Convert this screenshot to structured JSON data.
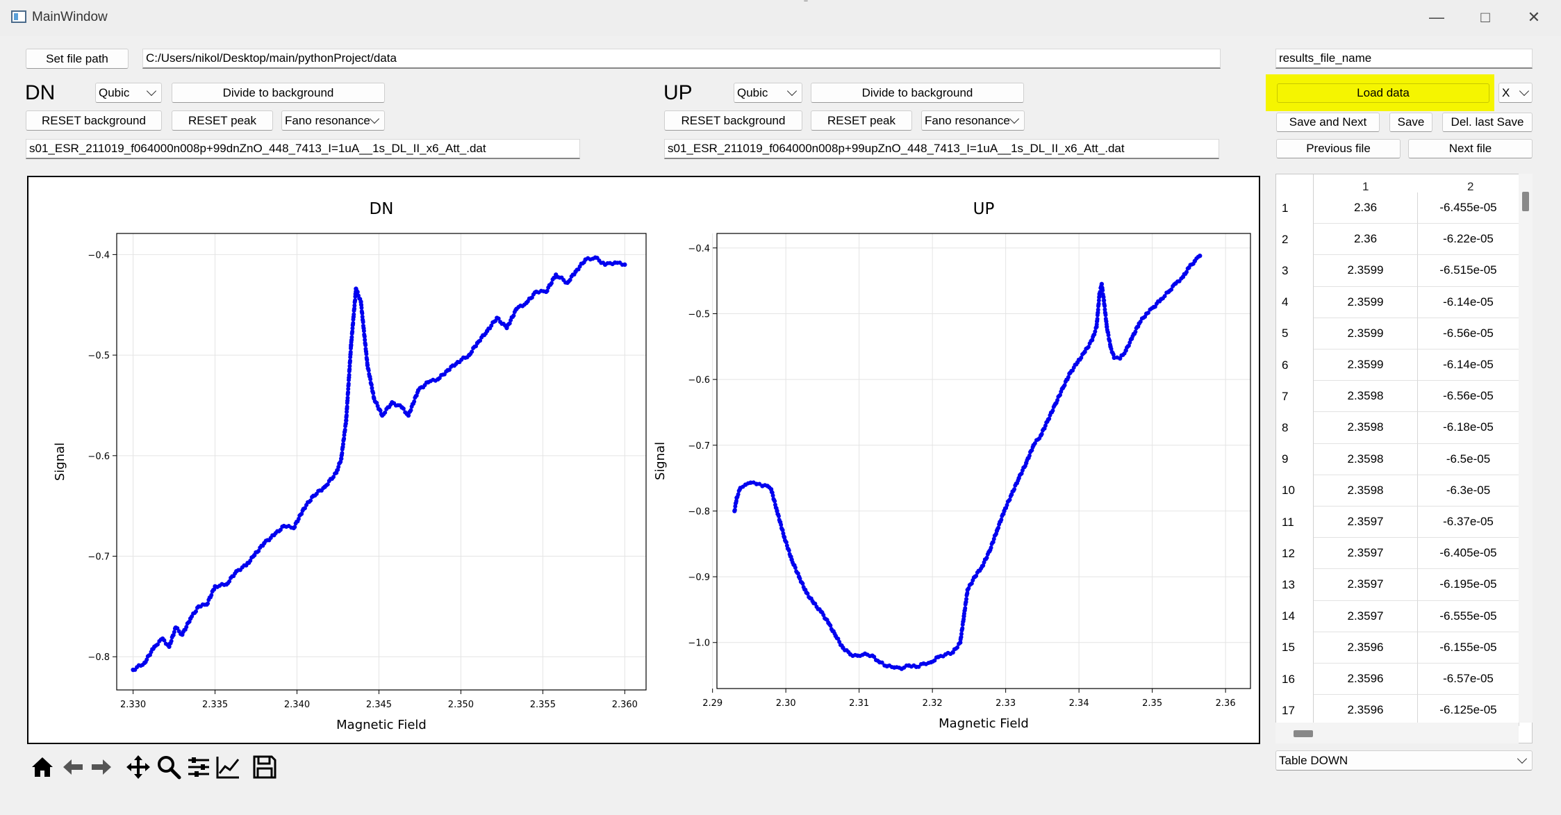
{
  "window": {
    "title": "MainWindow"
  },
  "top": {
    "set_file_path_label": "Set file path",
    "file_path_value": "C:/Users/nikol/Desktop/main/pythonProject/data",
    "results_file_name_value": "results_file_name",
    "load_data_label": "Load data",
    "axis_select_value": "X"
  },
  "dn_panel": {
    "label": "DN",
    "fit_select_value": "Qubic",
    "divide_label": "Divide to background",
    "reset_background_label": "RESET background",
    "reset_peak_label": "RESET peak",
    "peak_model_value": "Fano resonance",
    "file_name": "s01_ESR_211019_f064000n008p+99dnZnO_448_7413_I=1uA__1s_DL_II_x6_Att_.dat"
  },
  "up_panel": {
    "label": "UP",
    "fit_select_value": "Qubic",
    "divide_label": "Divide to background",
    "reset_background_label": "RESET background",
    "reset_peak_label": "RESET peak",
    "peak_model_value": "Fano resonance",
    "file_name": "s01_ESR_211019_f064000n008p+99upZnO_448_7413_I=1uA__1s_DL_II_x6_Att_.dat"
  },
  "actions": {
    "save_and_next": "Save and Next",
    "save": "Save",
    "del_last_save": "Del. last Save",
    "previous_file": "Previous file",
    "next_file": "Next file"
  },
  "table": {
    "columns": [
      "1",
      "2"
    ],
    "rows": [
      [
        "1",
        "2.36",
        "-6.455e-05"
      ],
      [
        "2",
        "2.36",
        "-6.22e-05"
      ],
      [
        "3",
        "2.3599",
        "-6.515e-05"
      ],
      [
        "4",
        "2.3599",
        "-6.14e-05"
      ],
      [
        "5",
        "2.3599",
        "-6.56e-05"
      ],
      [
        "6",
        "2.3599",
        "-6.14e-05"
      ],
      [
        "7",
        "2.3598",
        "-6.56e-05"
      ],
      [
        "8",
        "2.3598",
        "-6.18e-05"
      ],
      [
        "9",
        "2.3598",
        "-6.5e-05"
      ],
      [
        "10",
        "2.3598",
        "-6.3e-05"
      ],
      [
        "11",
        "2.3597",
        "-6.37e-05"
      ],
      [
        "12",
        "2.3597",
        "-6.405e-05"
      ],
      [
        "13",
        "2.3597",
        "-6.195e-05"
      ],
      [
        "14",
        "2.3597",
        "-6.555e-05"
      ],
      [
        "15",
        "2.3596",
        "-6.155e-05"
      ],
      [
        "16",
        "2.3596",
        "-6.57e-05"
      ],
      [
        "17",
        "2.3596",
        "-6.125e-05"
      ]
    ],
    "selector_value": "Table DOWN"
  },
  "toolbar": {
    "icons": [
      "home-icon",
      "back-arrow-icon",
      "forward-arrow-icon",
      "pan-icon",
      "zoom-icon",
      "configure-subplots-icon",
      "edit-axis-icon",
      "save-figure-icon"
    ]
  },
  "colors": {
    "highlight": "#f5f500",
    "series": "#0000ee"
  },
  "chart_data": [
    {
      "type": "scatter",
      "title": "DN",
      "xlabel": "Magnetic Field",
      "ylabel": "Signal",
      "xlim": [
        2.329,
        2.3613
      ],
      "ylim": [
        -0.833,
        -0.379
      ],
      "xticks": [
        "2.330",
        "2.335",
        "2.340",
        "2.345",
        "2.350",
        "2.355",
        "2.360"
      ],
      "xtick_values": [
        2.33,
        2.335,
        2.34,
        2.345,
        2.35,
        2.355,
        2.36
      ],
      "yticks": [
        "−0.4",
        "−0.5",
        "−0.6",
        "−0.7",
        "−0.8"
      ],
      "ytick_values": [
        -0.4,
        -0.5,
        -0.6,
        -0.7,
        -0.8
      ],
      "grid": true,
      "series": [
        {
          "points": [
            [
              2.33,
              -0.813
            ],
            [
              2.3307,
              -0.806
            ],
            [
              2.3313,
              -0.79
            ],
            [
              2.3318,
              -0.782
            ],
            [
              2.3322,
              -0.79
            ],
            [
              2.3326,
              -0.771
            ],
            [
              2.333,
              -0.778
            ],
            [
              2.3335,
              -0.762
            ],
            [
              2.334,
              -0.75
            ],
            [
              2.3345,
              -0.748
            ],
            [
              2.335,
              -0.73
            ],
            [
              2.3357,
              -0.728
            ],
            [
              2.3363,
              -0.715
            ],
            [
              2.3369,
              -0.709
            ],
            [
              2.3374,
              -0.699
            ],
            [
              2.338,
              -0.687
            ],
            [
              2.3386,
              -0.679
            ],
            [
              2.3392,
              -0.67
            ],
            [
              2.3398,
              -0.672
            ],
            [
              2.3404,
              -0.653
            ],
            [
              2.341,
              -0.64
            ],
            [
              2.3417,
              -0.631
            ],
            [
              2.3424,
              -0.617
            ],
            [
              2.3427,
              -0.603
            ],
            [
              2.343,
              -0.565
            ],
            [
              2.3433,
              -0.49
            ],
            [
              2.3436,
              -0.434
            ],
            [
              2.3439,
              -0.447
            ],
            [
              2.3443,
              -0.51
            ],
            [
              2.3447,
              -0.543
            ],
            [
              2.3452,
              -0.56
            ],
            [
              2.3458,
              -0.547
            ],
            [
              2.3464,
              -0.552
            ],
            [
              2.3468,
              -0.56
            ],
            [
              2.3474,
              -0.535
            ],
            [
              2.348,
              -0.527
            ],
            [
              2.3486,
              -0.524
            ],
            [
              2.3492,
              -0.515
            ],
            [
              2.3498,
              -0.507
            ],
            [
              2.3505,
              -0.5
            ],
            [
              2.351,
              -0.488
            ],
            [
              2.3516,
              -0.476
            ],
            [
              2.3522,
              -0.463
            ],
            [
              2.3528,
              -0.473
            ],
            [
              2.3534,
              -0.454
            ],
            [
              2.354,
              -0.448
            ],
            [
              2.3546,
              -0.437
            ],
            [
              2.3552,
              -0.437
            ],
            [
              2.3558,
              -0.42
            ],
            [
              2.3565,
              -0.428
            ],
            [
              2.357,
              -0.417
            ],
            [
              2.3576,
              -0.405
            ],
            [
              2.3582,
              -0.403
            ],
            [
              2.3588,
              -0.41
            ],
            [
              2.3594,
              -0.408
            ],
            [
              2.36,
              -0.41
            ]
          ]
        }
      ]
    },
    {
      "type": "scatter",
      "title": "UP",
      "xlabel": "Magnetic Field",
      "ylabel": "Signal",
      "xlim": [
        2.2906,
        2.3634
      ],
      "ylim": [
        -1.07,
        -0.378
      ],
      "xticks": [
        "2.29",
        "2.30",
        "2.31",
        "2.32",
        "2.33",
        "2.34",
        "2.35",
        "2.36"
      ],
      "xtick_values": [
        2.29,
        2.3,
        2.31,
        2.32,
        2.33,
        2.34,
        2.35,
        2.36
      ],
      "yticks": [
        "−0.4",
        "−0.5",
        "−0.6",
        "−0.7",
        "−0.8",
        "−0.9",
        "−1.0"
      ],
      "ytick_values": [
        -0.4,
        -0.5,
        -0.6,
        -0.7,
        -0.8,
        -0.9,
        -1.0
      ],
      "grid": true,
      "series": [
        {
          "points": [
            [
              2.293,
              -0.8
            ],
            [
              2.2933,
              -0.78
            ],
            [
              2.2938,
              -0.765
            ],
            [
              2.2945,
              -0.76
            ],
            [
              2.2952,
              -0.757
            ],
            [
              2.296,
              -0.759
            ],
            [
              2.2968,
              -0.762
            ],
            [
              2.2975,
              -0.762
            ],
            [
              2.298,
              -0.767
            ],
            [
              2.2988,
              -0.8
            ],
            [
              2.2998,
              -0.84
            ],
            [
              2.3008,
              -0.874
            ],
            [
              2.3018,
              -0.9
            ],
            [
              2.3028,
              -0.924
            ],
            [
              2.3038,
              -0.94
            ],
            [
              2.3048,
              -0.953
            ],
            [
              2.3058,
              -0.97
            ],
            [
              2.3068,
              -0.99
            ],
            [
              2.3078,
              -1.008
            ],
            [
              2.3088,
              -1.018
            ],
            [
              2.3098,
              -1.02
            ],
            [
              2.3108,
              -1.017
            ],
            [
              2.3118,
              -1.02
            ],
            [
              2.3128,
              -1.03
            ],
            [
              2.3138,
              -1.036
            ],
            [
              2.3148,
              -1.038
            ],
            [
              2.3158,
              -1.04
            ],
            [
              2.3168,
              -1.035
            ],
            [
              2.3178,
              -1.037
            ],
            [
              2.3188,
              -1.032
            ],
            [
              2.3198,
              -1.03
            ],
            [
              2.3208,
              -1.022
            ],
            [
              2.3218,
              -1.018
            ],
            [
              2.3228,
              -1.015
            ],
            [
              2.3238,
              -1.0
            ],
            [
              2.3243,
              -0.96
            ],
            [
              2.3248,
              -0.92
            ],
            [
              2.3258,
              -0.9
            ],
            [
              2.3268,
              -0.884
            ],
            [
              2.3278,
              -0.861
            ],
            [
              2.3288,
              -0.83
            ],
            [
              2.3298,
              -0.8
            ],
            [
              2.3308,
              -0.775
            ],
            [
              2.3318,
              -0.75
            ],
            [
              2.3328,
              -0.727
            ],
            [
              2.3338,
              -0.7
            ],
            [
              2.3348,
              -0.685
            ],
            [
              2.3358,
              -0.661
            ],
            [
              2.3368,
              -0.637
            ],
            [
              2.3378,
              -0.613
            ],
            [
              2.3388,
              -0.59
            ],
            [
              2.3398,
              -0.574
            ],
            [
              2.3408,
              -0.558
            ],
            [
              2.3418,
              -0.54
            ],
            [
              2.3424,
              -0.52
            ],
            [
              2.3428,
              -0.47
            ],
            [
              2.3431,
              -0.455
            ],
            [
              2.3434,
              -0.48
            ],
            [
              2.3438,
              -0.52
            ],
            [
              2.3443,
              -0.55
            ],
            [
              2.3448,
              -0.567
            ],
            [
              2.3456,
              -0.568
            ],
            [
              2.3464,
              -0.556
            ],
            [
              2.3472,
              -0.538
            ],
            [
              2.3482,
              -0.515
            ],
            [
              2.3492,
              -0.5
            ],
            [
              2.3502,
              -0.49
            ],
            [
              2.3512,
              -0.478
            ],
            [
              2.3522,
              -0.467
            ],
            [
              2.3532,
              -0.454
            ],
            [
              2.3542,
              -0.444
            ],
            [
              2.355,
              -0.43
            ],
            [
              2.3558,
              -0.42
            ],
            [
              2.3565,
              -0.412
            ]
          ]
        }
      ]
    }
  ]
}
